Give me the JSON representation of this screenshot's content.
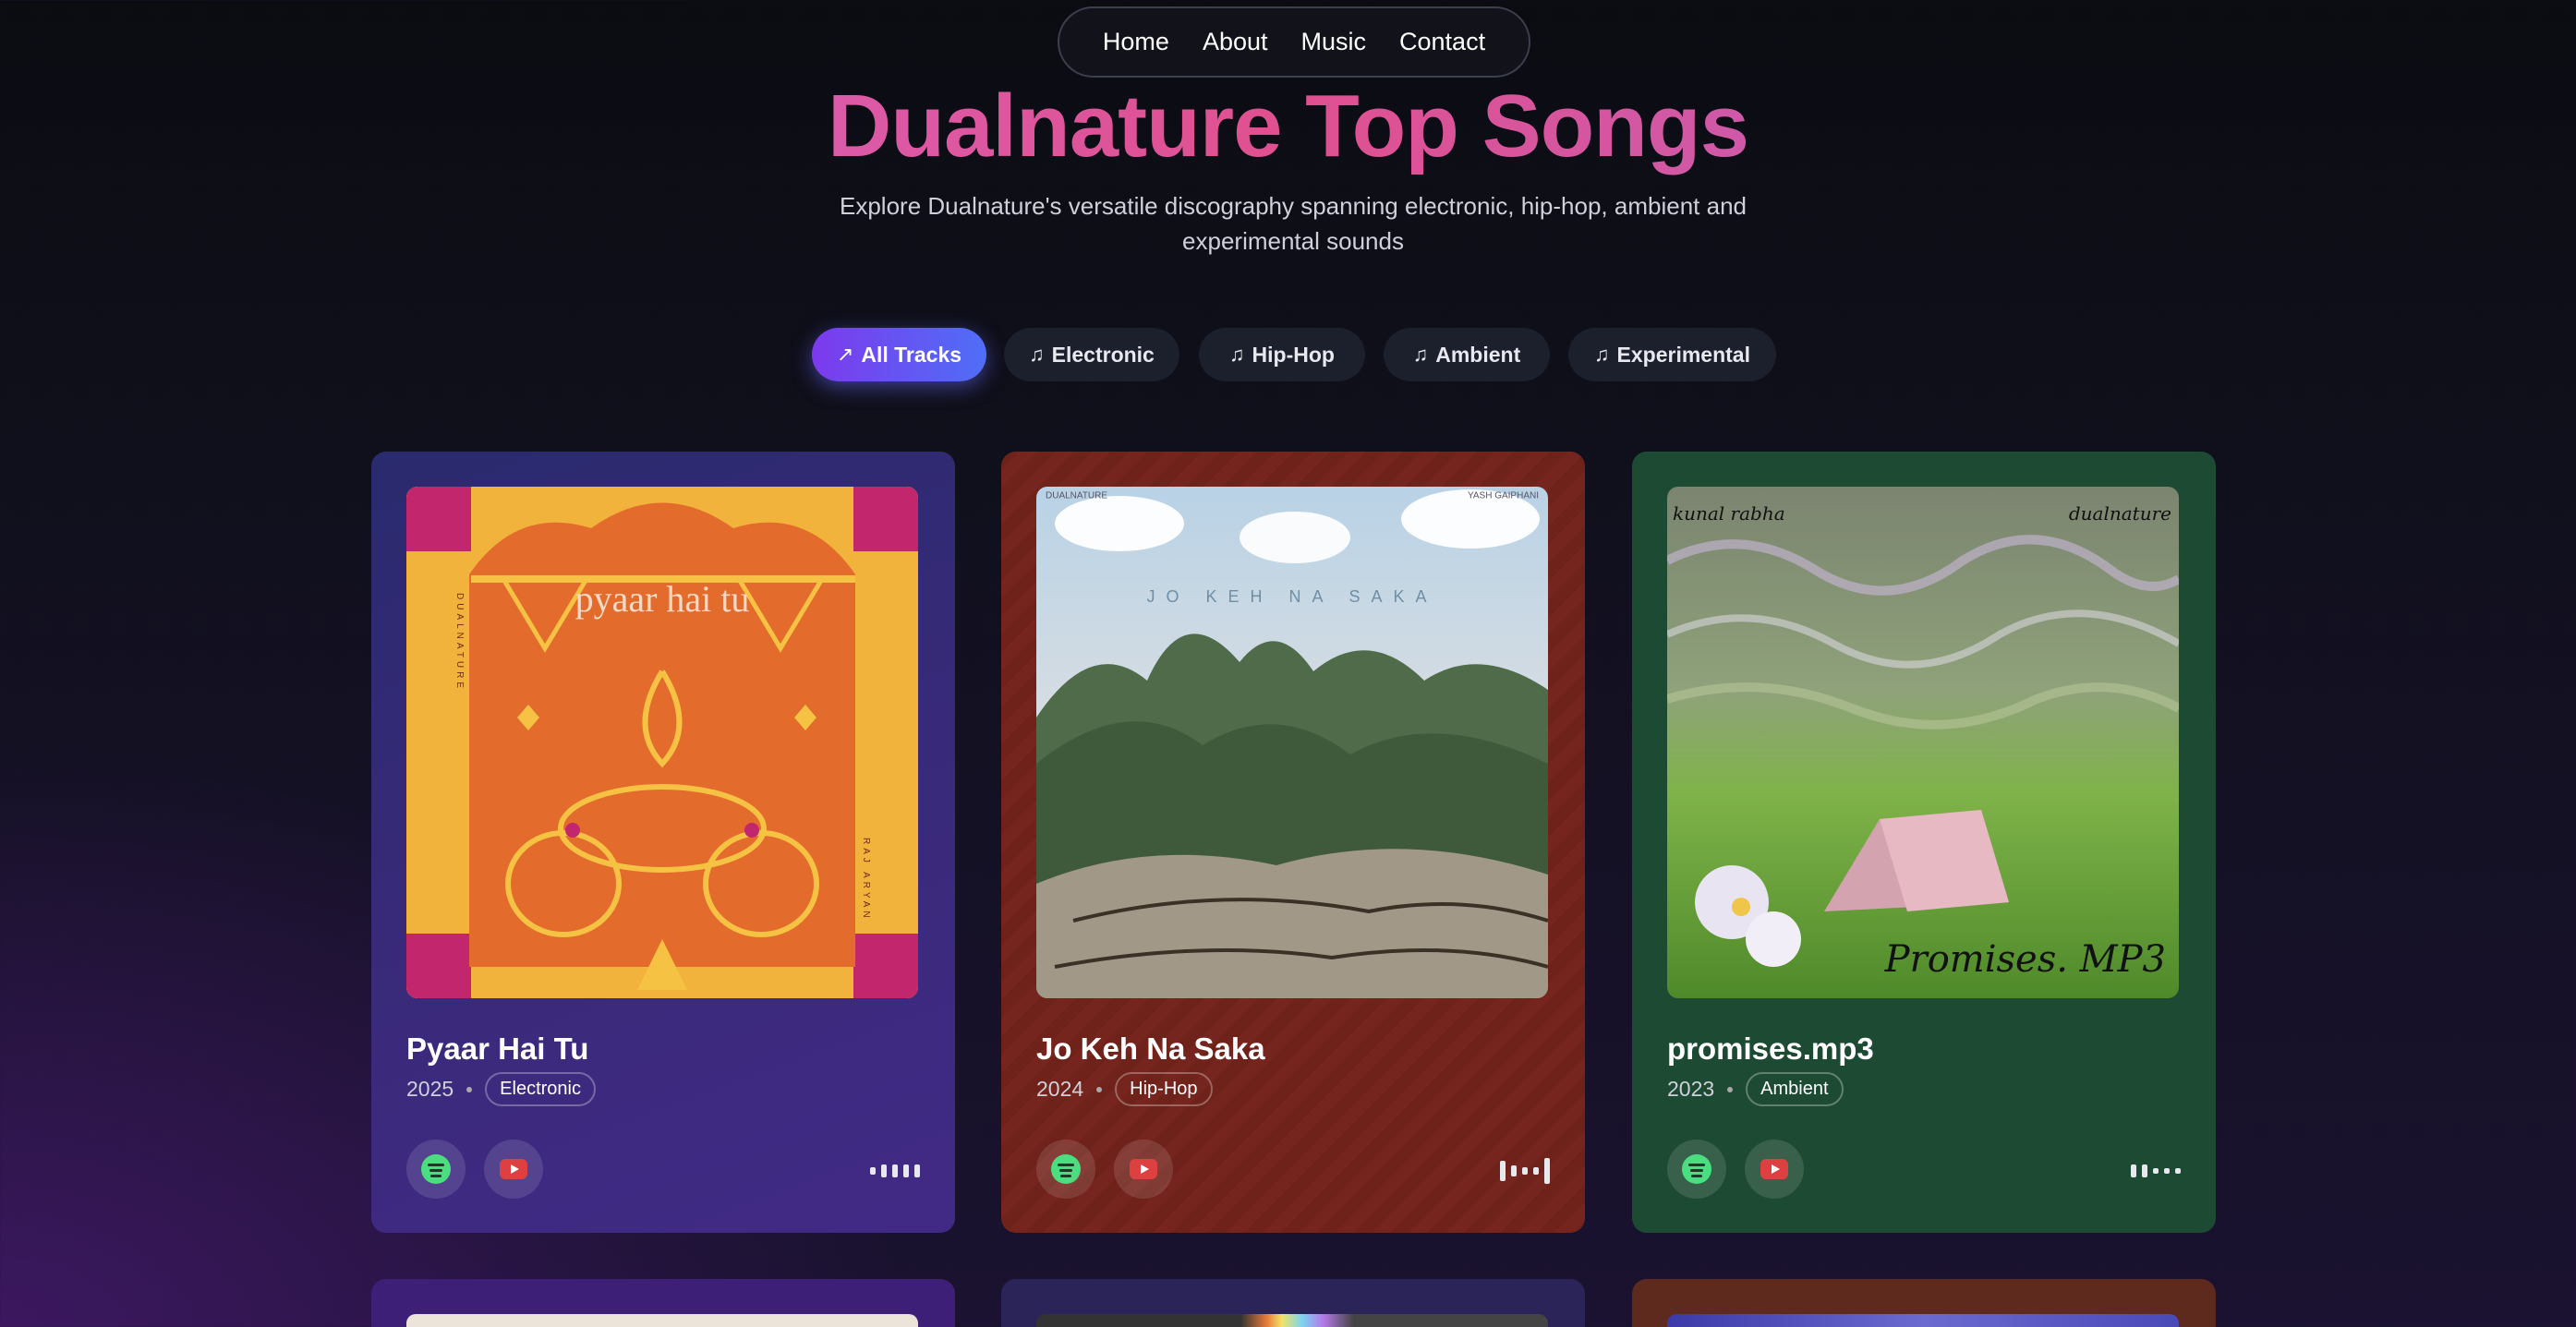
{
  "nav": {
    "items": [
      "Home",
      "About",
      "Music",
      "Contact"
    ]
  },
  "header": {
    "title": "Dualnature Top Songs",
    "subtitle": "Explore Dualnature's versatile discography spanning electronic, hip-hop, ambient and experimental sounds"
  },
  "filters": [
    {
      "label": "All Tracks",
      "icon": "trending-up-icon",
      "active": true
    },
    {
      "label": "Electronic",
      "icon": "music-note-icon",
      "active": false
    },
    {
      "label": "Hip-Hop",
      "icon": "music-note-icon",
      "active": false
    },
    {
      "label": "Ambient",
      "icon": "music-note-icon",
      "active": false
    },
    {
      "label": "Experimental",
      "icon": "music-note-icon",
      "active": false
    }
  ],
  "tracks": [
    {
      "title": "Pyaar Hai Tu",
      "year": "2025",
      "genre": "Electronic",
      "art": {
        "album_title": "pyaar hai tu",
        "side_left": "DUALNATURE",
        "side_right": "RAJ ARYAN"
      }
    },
    {
      "title": "Jo Keh Na Saka",
      "year": "2024",
      "genre": "Hip-Hop",
      "art": {
        "album_title": "JO KEH NA SAKA",
        "corner_left": "DUALNATURE",
        "corner_right": "YASH GAIPHANI"
      }
    },
    {
      "title": "promises.mp3",
      "year": "2023",
      "genre": "Ambient",
      "art": {
        "corner_left": "kunal rabha",
        "corner_right": "dualnature",
        "album_title": "Promises. MP3"
      }
    }
  ],
  "colors": {
    "accent_gradient": [
      "#7c3aed",
      "#4f6ef7"
    ],
    "title_gradient": [
      "#d46bd4",
      "#e0508f",
      "#b06ad6"
    ],
    "spotify": "#4ade80",
    "youtube": "#dc4040"
  }
}
